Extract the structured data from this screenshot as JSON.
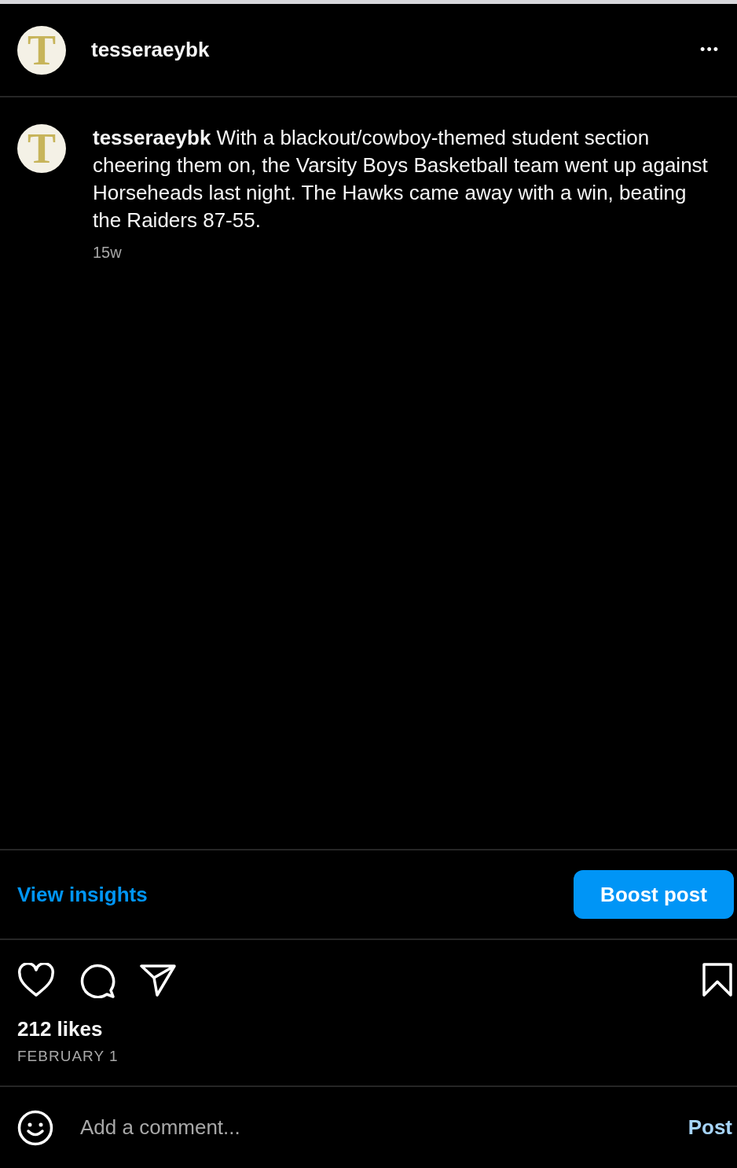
{
  "header": {
    "avatar_letter": "T",
    "username": "tesseraeybk",
    "more": "•••"
  },
  "caption": {
    "avatar_letter": "T",
    "username": "tesseraeybk",
    "text": "With a blackout/cowboy-themed student section cheering them on, the Varsity Boys Basketball team went up against Horseheads last night. The Hawks came away with a win, beating the Raiders 87-55.",
    "age": "15w"
  },
  "insights": {
    "link": "View insights",
    "button": "Boost post"
  },
  "stats": {
    "likes": "212 likes",
    "date": "FEBRUARY 1"
  },
  "comment": {
    "placeholder": "Add a comment...",
    "button": "Post"
  }
}
